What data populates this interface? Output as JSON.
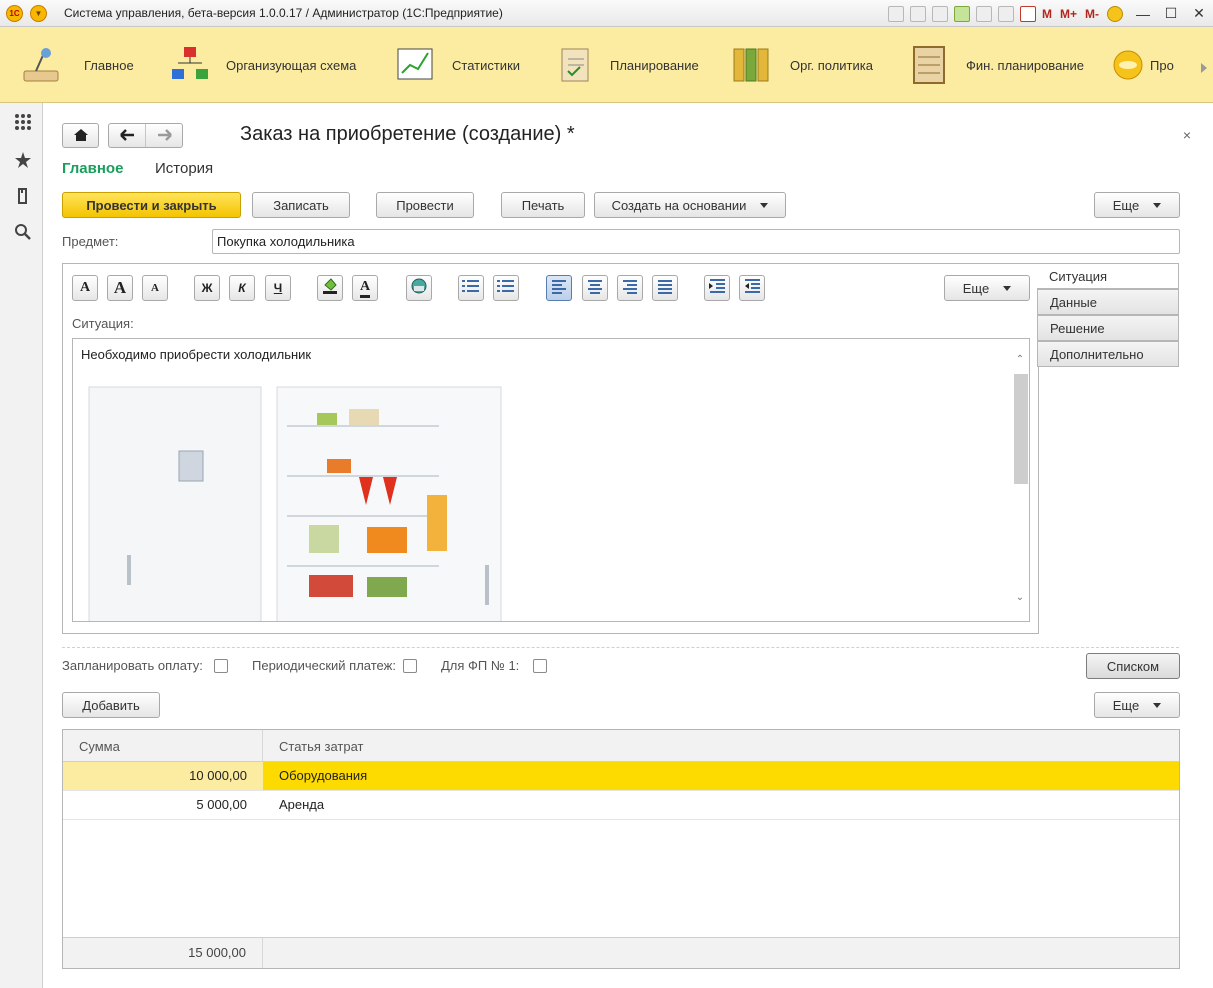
{
  "window": {
    "title": "Система управления, бета-версия 1.0.0.17 / Администратор  (1С:Предприятие)",
    "logo_text": "1С",
    "m_buttons": [
      "M",
      "M+",
      "M-"
    ],
    "minimize": "—",
    "maximize": "☐",
    "close": "✕"
  },
  "sections": [
    {
      "label": "Главное",
      "icon": "desk-lamp-icon"
    },
    {
      "label": "Организующая схема",
      "icon": "org-chart-icon"
    },
    {
      "label": "Статистики",
      "icon": "statistics-chart-icon"
    },
    {
      "label": "Планирование",
      "icon": "clipboard-checklist-icon"
    },
    {
      "label": "Орг. политика",
      "icon": "binders-icon"
    },
    {
      "label": "Фин. планирование",
      "icon": "abacus-icon"
    },
    {
      "label": "Про",
      "icon": "coin-icon"
    }
  ],
  "document": {
    "title": "Заказ на приобретение (создание) *",
    "close": "×",
    "tabs": [
      "Главное",
      "История"
    ]
  },
  "toolbar": {
    "post_close": "Провести и закрыть",
    "save": "Записать",
    "post": "Провести",
    "print": "Печать",
    "create_based": "Создать на основании",
    "more": "Еще"
  },
  "subject": {
    "label": "Предмет:",
    "value": "Покупка холодильника"
  },
  "editor": {
    "more": "Еще",
    "label": "Ситуация:",
    "text": "Необходимо приобрести холодильник",
    "format_buttons": [
      {
        "glyph": "A",
        "icon": "font-icon"
      },
      {
        "glyph": "A",
        "icon": "font-increase-icon"
      },
      {
        "glyph": "A",
        "icon": "font-decrease-icon"
      },
      {
        "glyph": "Ж",
        "icon": "bold-icon"
      },
      {
        "glyph": "К",
        "icon": "italic-icon"
      },
      {
        "glyph": "Ч",
        "icon": "underline-icon"
      },
      {
        "glyph": "",
        "icon": "fill-color-icon"
      },
      {
        "glyph": "A",
        "icon": "font-color-icon"
      },
      {
        "glyph": "",
        "icon": "insert-image-icon"
      },
      {
        "glyph": "",
        "icon": "bullet-list-icon"
      },
      {
        "glyph": "",
        "icon": "numbered-list-icon"
      },
      {
        "glyph": "",
        "icon": "align-left-icon"
      },
      {
        "glyph": "",
        "icon": "align-center-icon"
      },
      {
        "glyph": "",
        "icon": "align-right-icon"
      },
      {
        "glyph": "",
        "icon": "justify-icon"
      },
      {
        "glyph": "",
        "icon": "indent-increase-icon"
      },
      {
        "glyph": "",
        "icon": "indent-decrease-icon"
      }
    ]
  },
  "side_tabs": [
    "Ситуация",
    "Данные",
    "Решение",
    "Дополнительно"
  ],
  "options": {
    "plan_payment": "Запланировать оплату:",
    "periodic": "Периодический платеж:",
    "fp": "Для ФП № 1:",
    "list_button": "Списком"
  },
  "table": {
    "add": "Добавить",
    "more": "Еще",
    "headers": [
      "Сумма",
      "Статья затрат"
    ],
    "rows": [
      {
        "amount": "10 000,00",
        "item": "Оборудования"
      },
      {
        "amount": "5 000,00",
        "item": "Аренда"
      }
    ],
    "total": "15 000,00"
  }
}
